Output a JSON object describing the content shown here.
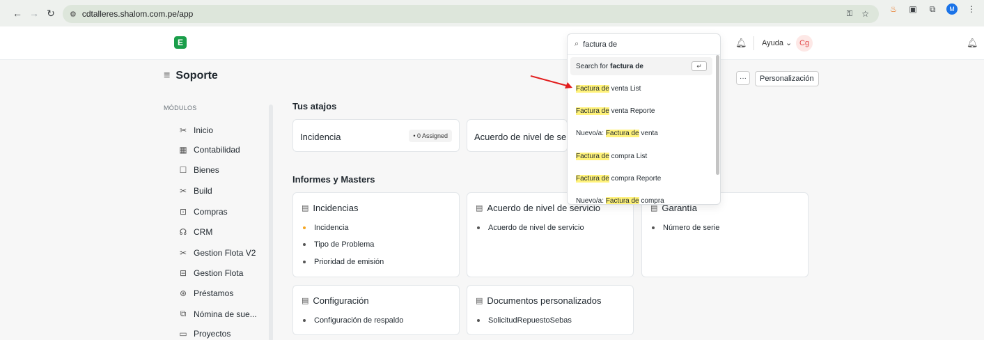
{
  "browser": {
    "url": "cdtalleres.shalom.com.pe/app",
    "avatar_letter": "M"
  },
  "navbar": {
    "help_label": "Ayuda ⌄",
    "user_initials": "Cg"
  },
  "page": {
    "title": "Soporte",
    "more_label": "···",
    "personalize_label": "Personalización"
  },
  "sidebar": {
    "section_label": "MÓDULOS",
    "items": [
      {
        "label": "Inicio",
        "icon": "tools-icon"
      },
      {
        "label": "Contabilidad",
        "icon": "calculator-icon"
      },
      {
        "label": "Bienes",
        "icon": "box-icon"
      },
      {
        "label": "Build",
        "icon": "tools-icon"
      },
      {
        "label": "Compras",
        "icon": "bag-icon"
      },
      {
        "label": "CRM",
        "icon": "crm-icon"
      },
      {
        "label": "Gestion Flota V2",
        "icon": "tools-icon"
      },
      {
        "label": "Gestion Flota",
        "icon": "briefcase-icon"
      },
      {
        "label": "Préstamos",
        "icon": "loan-icon"
      },
      {
        "label": "Nómina de sue...",
        "icon": "payroll-icon"
      },
      {
        "label": "Proyectos",
        "icon": "folder-icon"
      }
    ]
  },
  "shortcuts": {
    "heading": "Tus atajos",
    "items": [
      {
        "label": "Incidencia",
        "badge": "• 0 Assigned"
      },
      {
        "label": "Acuerdo de nivel de serv"
      }
    ]
  },
  "reports": {
    "heading": "Informes y Masters",
    "cards": [
      {
        "title": "Incidencias",
        "links": [
          "Incidencia",
          "Tipo de Problema",
          "Prioridad de emisión"
        ]
      },
      {
        "title": "Acuerdo de nivel de servicio",
        "links": [
          "Acuerdo de nivel de servicio"
        ]
      },
      {
        "title": "Garantía",
        "links": [
          "Número de serie"
        ]
      },
      {
        "title": "Configuración",
        "links": [
          "Configuración de respaldo"
        ]
      },
      {
        "title": "Documentos personalizados",
        "links": [
          "SolicitudRepuestoSebas"
        ]
      }
    ]
  },
  "search": {
    "value": "factura de",
    "search_for_prefix": "Search for",
    "search_for_term": "factura de",
    "enter_glyph": "↵",
    "results": [
      {
        "pre": "",
        "hl": "Factura de",
        "post": " venta List"
      },
      {
        "pre": "",
        "hl": "Factura de",
        "post": " venta Reporte"
      },
      {
        "pre": "Nuevo/a: ",
        "hl": "Factura de",
        "post": " venta"
      },
      {
        "pre": "",
        "hl": "Factura de",
        "post": " compra List"
      },
      {
        "pre": "",
        "hl": "Factura de",
        "post": " compra Reporte"
      },
      {
        "pre": "Nuevo/a: ",
        "hl": "Factura de",
        "post": " compra"
      }
    ]
  },
  "colors": {
    "annotation_arrow": "#e21d1d",
    "highlight": "#fff27a",
    "logo": "#1a9e4a"
  }
}
